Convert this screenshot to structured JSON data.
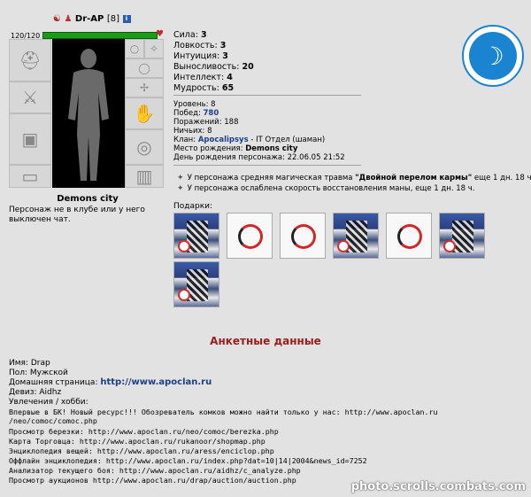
{
  "character": {
    "name": "Dr-AP",
    "level": "[8]",
    "info_badge": "i",
    "hp": "120/120",
    "city": "Demons city",
    "status": "Персонаж не в клубе или у него выключен чат."
  },
  "stats": [
    {
      "label": "Сила:",
      "value": "3"
    },
    {
      "label": "Ловкость:",
      "value": "3"
    },
    {
      "label": "Интуиция:",
      "value": "3"
    },
    {
      "label": "Выносливость:",
      "value": "20"
    },
    {
      "label": "Интеллект:",
      "value": "4"
    },
    {
      "label": "Мудрость:",
      "value": "65"
    }
  ],
  "info": {
    "level": "Уровень: 8",
    "wins_label": "Побед:",
    "wins": "780",
    "losses": "Поражений: 188",
    "draws": "Ничьих: 8",
    "clan_label": "Клан:",
    "clan": "Apocalipsys",
    "clan_rank": "- IT Отдел (шаман)",
    "birthplace_label": "Место рождения:",
    "birthplace": "Demons city",
    "birthday": "День рождения персонажа: 22.06.05 21:52"
  },
  "effects": [
    {
      "prefix": "У персонажа средняя магическая травма ",
      "highlight": "\"Двойной перелом кармы\"",
      "suffix": " еще 1 дн. 18 ч."
    },
    {
      "prefix": "У персонажа ослаблена скорость восстановления маны, еще 1 дн. 18 ч.",
      "highlight": "",
      "suffix": ""
    }
  ],
  "gifts_label": "Подарки:",
  "gifts": [
    "tree",
    "swirl",
    "swirl",
    "tree",
    "swirl",
    "tree",
    "tree"
  ],
  "anketa": {
    "title": "Анкетные данные",
    "name": "Имя: Drap",
    "gender": "Пол: Мужской",
    "homepage_label": "Домашняя страница:",
    "homepage": "http://www.apoclan.ru",
    "motto": "Девиз: Aidhz",
    "hobbies_label": "Увлечения / хобби:",
    "hobbies": [
      "Впервые в БК! Новый ресурс!!! Обозреватель комков можно найти только у нас: http://www.apoclan.ru",
      "/neo/comoc/comoc.php",
      "Просмотр березки: http://www.apoclan.ru/neo/comoc/berezka.php",
      "Карта Торговца: http://www.apoclan.ru/rukanoor/shopmap.php",
      "Энциклопедия вещей: http://www.apoclan.ru/aress/enciclop.php",
      "Оффлайн энциклопедия: http://www.apoclan.ru/index.php?dat=10|14|2004&news_id=7252",
      "Анализатор текущего боя: http://www.apoclan.ru/aidhz/c_analyze.php",
      "Просмотр аукционов http://www.apoclan.ru/drap/auction/auction.php"
    ]
  },
  "watermark": "photo.scrolls.combats.com",
  "colors": {
    "background": "#e2e2e2",
    "hp": "#1a9c1a",
    "link": "#1b3f8a",
    "title": "#9a1d1d",
    "emblem": "#1b84d0"
  }
}
